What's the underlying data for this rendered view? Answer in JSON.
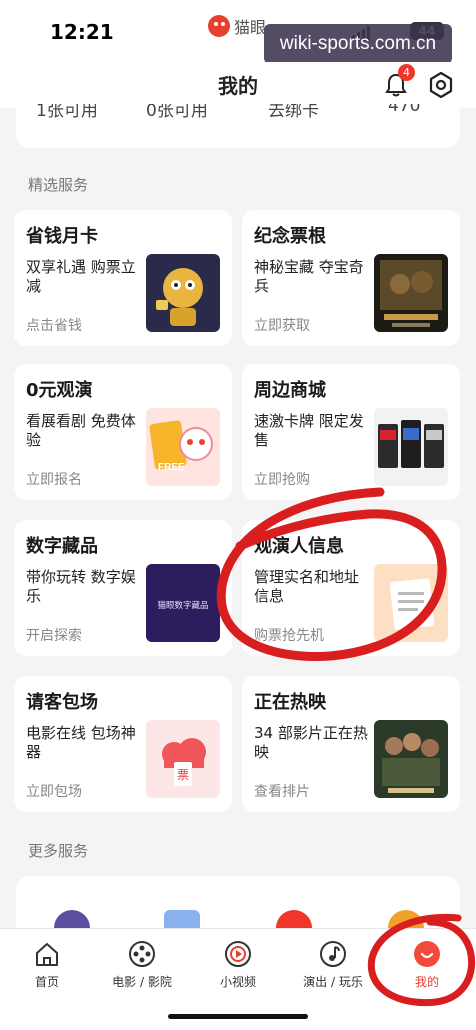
{
  "status_bar": {
    "time": "12:21",
    "app_name": "猫眼",
    "battery": "44"
  },
  "watermark": "wiki-sports.com.cn",
  "header": {
    "title": "我的",
    "notification_count": "4"
  },
  "top_card": [
    "1张可用",
    "0张可用",
    "去绑卡",
    "470"
  ],
  "selected_services": {
    "title": "精选服务",
    "cards": [
      {
        "title": "省钱月卡",
        "desc": "双享礼遇 购票立减",
        "cta": "点击省钱"
      },
      {
        "title": "纪念票根",
        "desc": "神秘宝藏 夺宝奇兵",
        "cta": "立即获取"
      },
      {
        "title": "0元观演",
        "desc": "看展看剧 免费体验",
        "cta": "立即报名",
        "thumb_text": "FREE"
      },
      {
        "title": "周边商城",
        "desc": "速激卡牌 限定发售",
        "cta": "立即抢购"
      },
      {
        "title": "数字藏品",
        "desc": "带你玩转 数字娱乐",
        "cta": "开启探索",
        "thumb_text": "猫眼数字藏品"
      },
      {
        "title": "观演人信息",
        "desc": "管理实名和地址信息",
        "cta": "购票抢先机"
      },
      {
        "title": "请客包场",
        "desc": "电影在线 包场神器",
        "cta": "立即包场",
        "thumb_text": "票"
      },
      {
        "title": "正在热映",
        "desc": "34 部影片正在热映",
        "cta": "查看排片"
      }
    ]
  },
  "more_services": {
    "title": "更多服务"
  },
  "tab_bar": [
    {
      "label": "首页",
      "icon": "home-icon"
    },
    {
      "label": "电影 / 影院",
      "icon": "film-reel-icon"
    },
    {
      "label": "小视频",
      "icon": "play-icon"
    },
    {
      "label": "演出 / 玩乐",
      "icon": "music-note-icon"
    },
    {
      "label": "我的",
      "icon": "profile-smile-icon",
      "active": true
    }
  ],
  "colors": {
    "accent": "#e8402f",
    "annotation": "#d81e1e",
    "background": "#f4f4f4"
  }
}
